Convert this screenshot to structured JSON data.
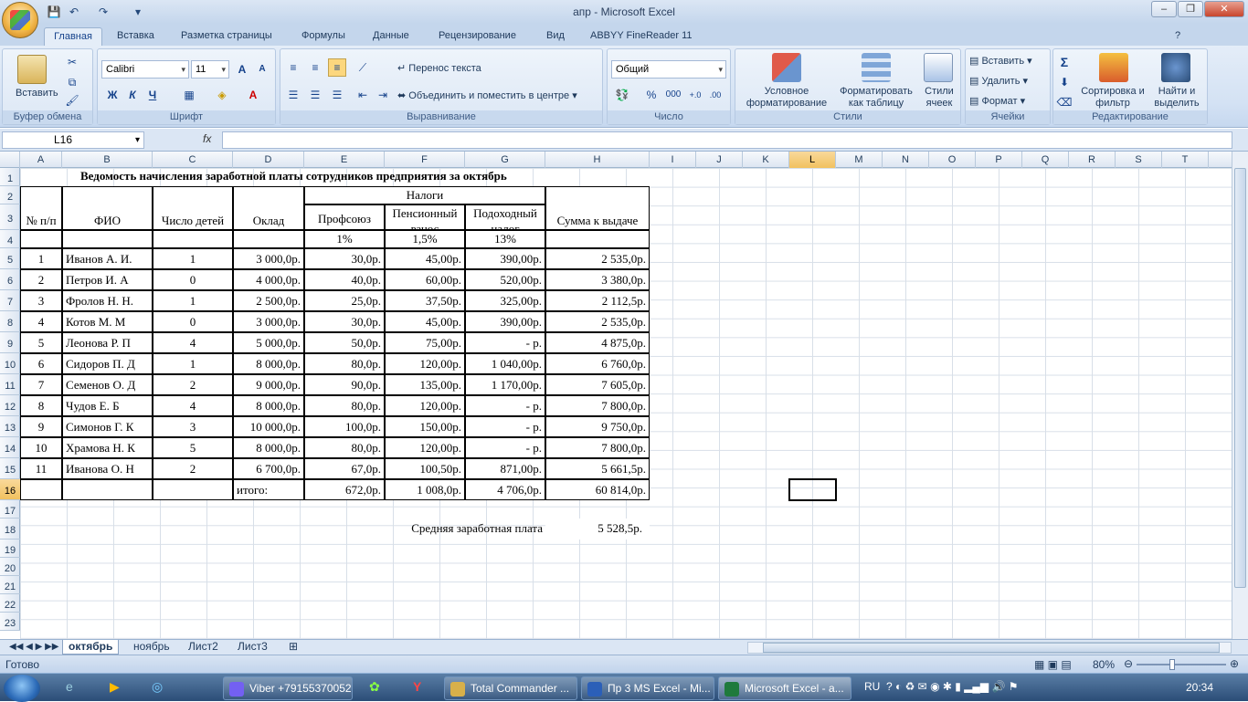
{
  "window": {
    "title": "апр - Microsoft Excel",
    "min": "–",
    "restore": "❐",
    "close": "✕"
  },
  "quick_access": {
    "save": "💾",
    "undo": "↶",
    "redo": "↷",
    "more": "▾"
  },
  "tabs": [
    "Главная",
    "Вставка",
    "Разметка страницы",
    "Формулы",
    "Данные",
    "Рецензирование",
    "Вид",
    "ABBYY FineReader 11"
  ],
  "ribbon": {
    "clipboard": {
      "label": "Буфер обмена",
      "paste": "Вставить"
    },
    "font": {
      "label": "Шрифт",
      "name": "Calibri",
      "size": "11",
      "bold": "Ж",
      "italic": "К",
      "underline": "Ч",
      "grow": "A",
      "shrink": "A"
    },
    "alignment": {
      "label": "Выравнивание",
      "wrap": "Перенос текста",
      "merge": "Объединить и поместить в центре"
    },
    "number": {
      "label": "Число",
      "format": "Общий",
      "percent": "%",
      "thousands": "000"
    },
    "styles": {
      "label": "Стили",
      "conditional": "Условное форматирование",
      "as_table": "Форматировать как таблицу",
      "cell_styles": "Стили ячеек"
    },
    "cells": {
      "label": "Ячейки",
      "insert": "Вставить",
      "delete": "Удалить",
      "format": "Формат"
    },
    "editing": {
      "label": "Редактирование",
      "sum": "Σ",
      "sort": "Сортировка и фильтр",
      "find": "Найти и выделить"
    }
  },
  "formula_bar": {
    "name_box": "L16",
    "fx": "fx",
    "value": ""
  },
  "columns": [
    "A",
    "B",
    "C",
    "D",
    "E",
    "F",
    "G",
    "H",
    "I",
    "J",
    "K",
    "L",
    "M",
    "N",
    "O",
    "P",
    "Q",
    "R",
    "S",
    "T"
  ],
  "rows": [
    "1",
    "2",
    "3",
    "4",
    "5",
    "6",
    "7",
    "8",
    "9",
    "10",
    "11",
    "12",
    "13",
    "14",
    "15",
    "16",
    "17",
    "18",
    "19",
    "20",
    "21",
    "22",
    "23"
  ],
  "sheet": {
    "title": "Ведомость начисления заработной платы сотрудников предприятия за октябрь",
    "headers": {
      "num": "№ п/п",
      "fio": "ФИО",
      "children": "Число детей",
      "salary": "Оклад",
      "taxes": "Налоги",
      "union": "Профсоюз",
      "pension": "Пенсионный взнос",
      "income": "Подоходный налог",
      "total": "Сумма к выдаче"
    },
    "rates": {
      "union": "1%",
      "pension": "1,5%",
      "income": "13%"
    },
    "data": [
      [
        "1",
        "Иванов А. И.",
        "1",
        "3 000,0р.",
        "30,0р.",
        "45,00р.",
        "390,00р.",
        "2 535,0р."
      ],
      [
        "2",
        "Петров И. А",
        "0",
        "4 000,0р.",
        "40,0р.",
        "60,00р.",
        "520,00р.",
        "3 380,0р."
      ],
      [
        "3",
        "Фролов Н. Н.",
        "1",
        "2 500,0р.",
        "25,0р.",
        "37,50р.",
        "325,00р.",
        "2 112,5р."
      ],
      [
        "4",
        "Котов М. М",
        "0",
        "3 000,0р.",
        "30,0р.",
        "45,00р.",
        "390,00р.",
        "2 535,0р."
      ],
      [
        "5",
        "Леонова Р. П",
        "4",
        "5 000,0р.",
        "50,0р.",
        "75,00р.",
        "-  р.",
        "4 875,0р."
      ],
      [
        "6",
        "Сидоров П. Д",
        "1",
        "8 000,0р.",
        "80,0р.",
        "120,00р.",
        "1 040,00р.",
        "6 760,0р."
      ],
      [
        "7",
        "Семенов О. Д",
        "2",
        "9 000,0р.",
        "90,0р.",
        "135,00р.",
        "1 170,00р.",
        "7 605,0р."
      ],
      [
        "8",
        "Чудов Е. Б",
        "4",
        "8 000,0р.",
        "80,0р.",
        "120,00р.",
        "-  р.",
        "7 800,0р."
      ],
      [
        "9",
        "Симонов Г. К",
        "3",
        "10 000,0р.",
        "100,0р.",
        "150,00р.",
        "-  р.",
        "9 750,0р."
      ],
      [
        "10",
        "Храмова Н. К",
        "5",
        "8 000,0р.",
        "80,0р.",
        "120,00р.",
        "-  р.",
        "7 800,0р."
      ],
      [
        "11",
        "Иванова О. Н",
        "2",
        "6 700,0р.",
        "67,0р.",
        "100,50р.",
        "871,00р.",
        "5 661,5р."
      ]
    ],
    "totals": {
      "label": "итого:",
      "union": "672,0р.",
      "pension": "1 008,0р.",
      "income": "4 706,0р.",
      "total": "60 814,0р."
    },
    "average": {
      "label": "Средняя заработная плата",
      "value": "5 528,5р."
    }
  },
  "sheet_tabs": [
    "октябрь",
    "ноябрь",
    "Лист2",
    "Лист3"
  ],
  "status": {
    "ready": "Готово",
    "zoom": "80%"
  },
  "taskbar": {
    "items": [
      "Viber +79155370052",
      "Total Commander ...",
      "Пр 3 MS Excel - Mi...",
      "Microsoft Excel - a..."
    ],
    "lang": "RU",
    "time": "20:34"
  }
}
